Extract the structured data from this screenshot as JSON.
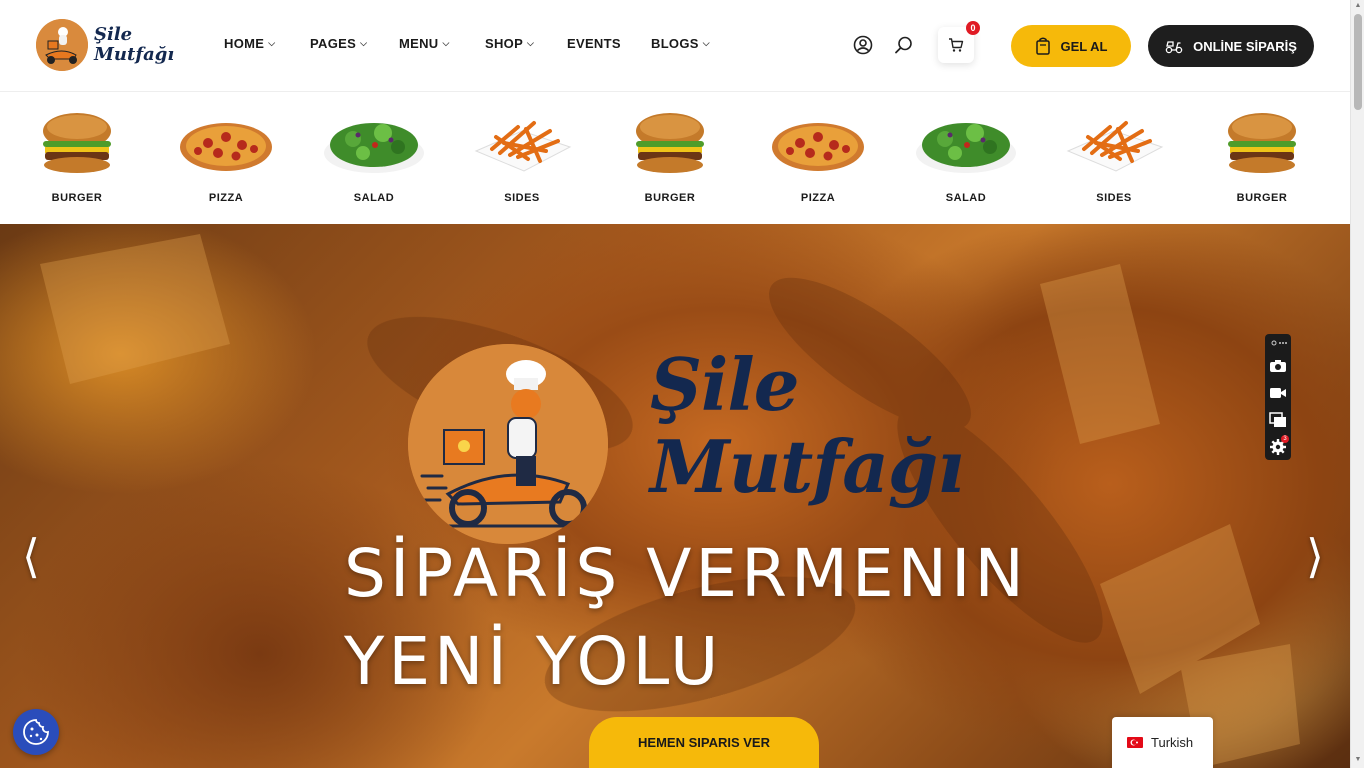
{
  "brand": {
    "line1": "Şile",
    "line2": "Mutfağı"
  },
  "nav": [
    {
      "label": "HOME",
      "dropdown": true
    },
    {
      "label": "PAGES",
      "dropdown": true
    },
    {
      "label": "MENU",
      "dropdown": true
    },
    {
      "label": "SHOP",
      "dropdown": true
    },
    {
      "label": "EVENTS",
      "dropdown": false
    },
    {
      "label": "BLOGS",
      "dropdown": true
    }
  ],
  "cart": {
    "count": "0"
  },
  "buttons": {
    "pickup": "GEL AL",
    "online_order": "ONLİNE SİPARİŞ"
  },
  "categories": [
    "BURGER",
    "PIZZA",
    "SALAD",
    "SIDES",
    "BURGER",
    "PIZZA",
    "SALAD",
    "SIDES",
    "BURGER"
  ],
  "hero": {
    "brand_line1": "Şile",
    "brand_line2": "Mutfağı",
    "title_line1": "SİPARİŞ VERMENIN",
    "title_line2": "YENİ YOLU",
    "cta": "HEMEN SIPARIS VER"
  },
  "language": {
    "label": "Turkish"
  },
  "toolbar": {
    "badge": "3"
  },
  "colors": {
    "accent": "#f6b90a",
    "dark": "#1e1e1e",
    "brand_navy": "#13284f",
    "cart_badge": "#e01b24"
  },
  "icons": [
    "user-icon",
    "search-icon",
    "cart-icon",
    "bag-icon",
    "scooter-icon",
    "camera-icon",
    "video-icon",
    "layers-icon",
    "gear-icon",
    "cookie-icon",
    "flag-icon"
  ]
}
